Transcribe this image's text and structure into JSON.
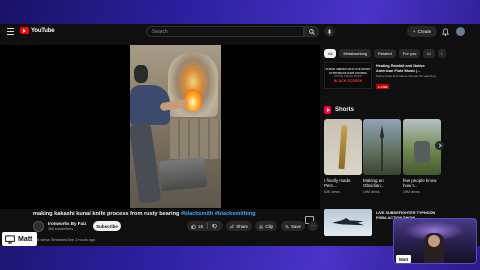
{
  "masthead": {
    "logo_text": "YouTube",
    "search_placeholder": "Search",
    "create_label": "Create"
  },
  "video": {
    "title_main": "making kakashi kunai knife process from rusty bearing ",
    "title_tags": "#blacksmith #blacksmithing",
    "channel_name": "Ironworks By Faiz",
    "subscriber_count": "36k subscribers",
    "subscribe_label": "Subscribe",
    "like_count": "18",
    "share_label": "Share",
    "clip_label": "Clip",
    "save_label": "Save",
    "views_line": "258 views  Streamed live 2 hours ago"
  },
  "chips": [
    "All",
    "Metalworking",
    "Related",
    "For you",
    "Li"
  ],
  "ad": {
    "thumb_line1": "SUPER AMERICAN FLUTE MUSIC SYNTHWAVE RAIN SOUNDS",
    "thumb_line2": "NATIVE & BLUE SPIRIT",
    "thumb_line3": "BLACK SCREEN",
    "title": "Healing Rainfall and Native American Flute Music |...",
    "meta": "Native Flute and Nature Sounds  66 watching",
    "live_label": "LIVE"
  },
  "shorts": {
    "header": "Shorts",
    "items": [
      {
        "title": "I finally made Perc...",
        "views": "83K views"
      },
      {
        "title": "Making an Obsidian...",
        "views": "19M views"
      },
      {
        "title": "few people know how t...",
        "views": "19M views"
      }
    ]
  },
  "recommended": {
    "title": "LIVE SUBDEFIGHTER TYPHOON FGBA ACTION SHOW..."
  },
  "overlays": {
    "name_tag": "Matt",
    "cam_label": "Matt"
  }
}
